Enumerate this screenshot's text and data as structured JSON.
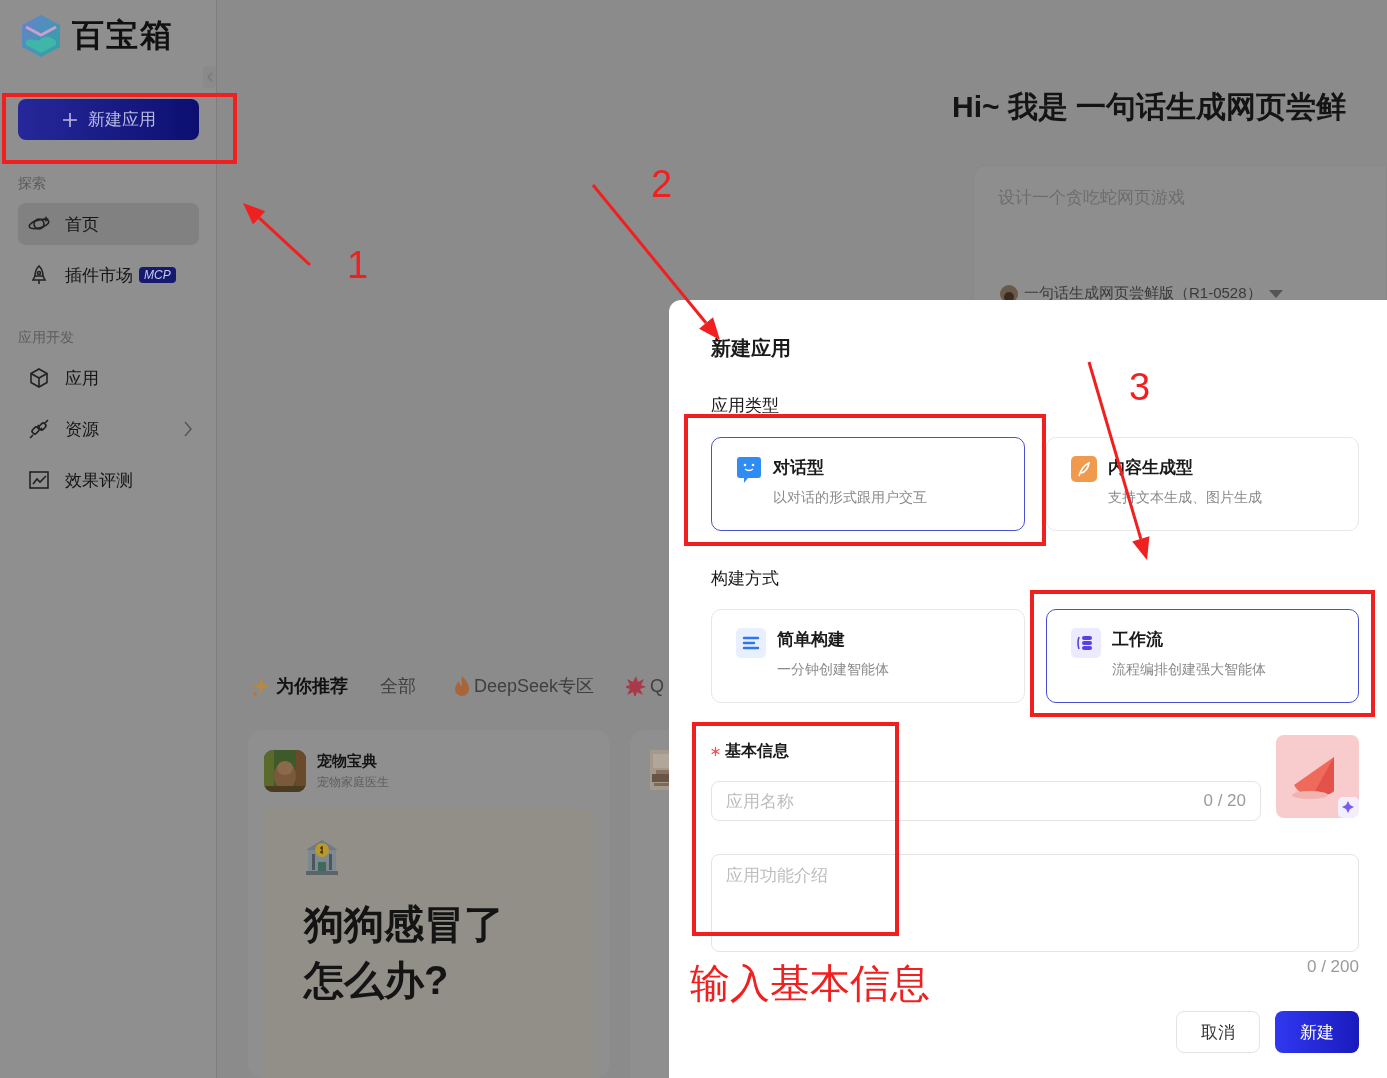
{
  "sidebar": {
    "logo_text": "百宝箱",
    "new_app_button": "新建应用",
    "sections": [
      {
        "title": "探索",
        "items": [
          {
            "label": "首页",
            "selected": true,
            "expandable": false
          },
          {
            "label": "插件市场",
            "badge": "MCP",
            "selected": false,
            "expandable": false
          }
        ]
      },
      {
        "title": "应用开发",
        "items": [
          {
            "label": "应用",
            "selected": false,
            "expandable": false
          },
          {
            "label": "资源",
            "selected": false,
            "expandable": true
          },
          {
            "label": "效果评测",
            "selected": false,
            "expandable": false
          }
        ]
      }
    ]
  },
  "main": {
    "greeting": "Hi~ 我是 一句话生成网页尝鲜",
    "prompt": {
      "placeholder": "设计一个贪吃蛇网页游戏",
      "model": "一句话生成网页尝鲜版（R1-0528）"
    },
    "tabs": [
      {
        "label": "为你推荐",
        "selected": true
      },
      {
        "label": "全部",
        "selected": false
      },
      {
        "label": "DeepSeek专区",
        "selected": false
      },
      {
        "label": "Q",
        "selected": false
      }
    ],
    "cards": [
      {
        "name": "宠物宝典",
        "subtitle": "宠物家庭医生",
        "poster_lines": [
          "狗狗感冒了",
          "怎么办?"
        ]
      },
      {
        "kind": "picture"
      }
    ]
  },
  "dialog": {
    "title": "新建应用",
    "app_type": {
      "label": "应用类型",
      "options": [
        {
          "title": "对话型",
          "description": "以对话的形式跟用户交互",
          "selected": true
        },
        {
          "title": "内容生成型",
          "description": "支持文本生成、图片生成",
          "selected": false
        }
      ]
    },
    "build_method": {
      "label": "构建方式",
      "options": [
        {
          "title": "简单构建",
          "description": "一分钟创建智能体",
          "selected": false
        },
        {
          "title": "工作流",
          "description": "流程编排创建强大智能体",
          "selected": true
        }
      ]
    },
    "basic_info": {
      "label": "基本信息",
      "required": true,
      "name_field": {
        "placeholder": "应用名称",
        "counter": "0 / 20"
      },
      "description_field": {
        "placeholder": "应用功能介绍",
        "counter": "0 / 200"
      }
    },
    "buttons": [
      {
        "label": "取消",
        "kind": "secondary"
      },
      {
        "label": "新建",
        "kind": "primary"
      }
    ]
  },
  "annotations": {
    "step_numbers": [
      "1",
      "2",
      "3"
    ],
    "note": "输入基本信息"
  }
}
